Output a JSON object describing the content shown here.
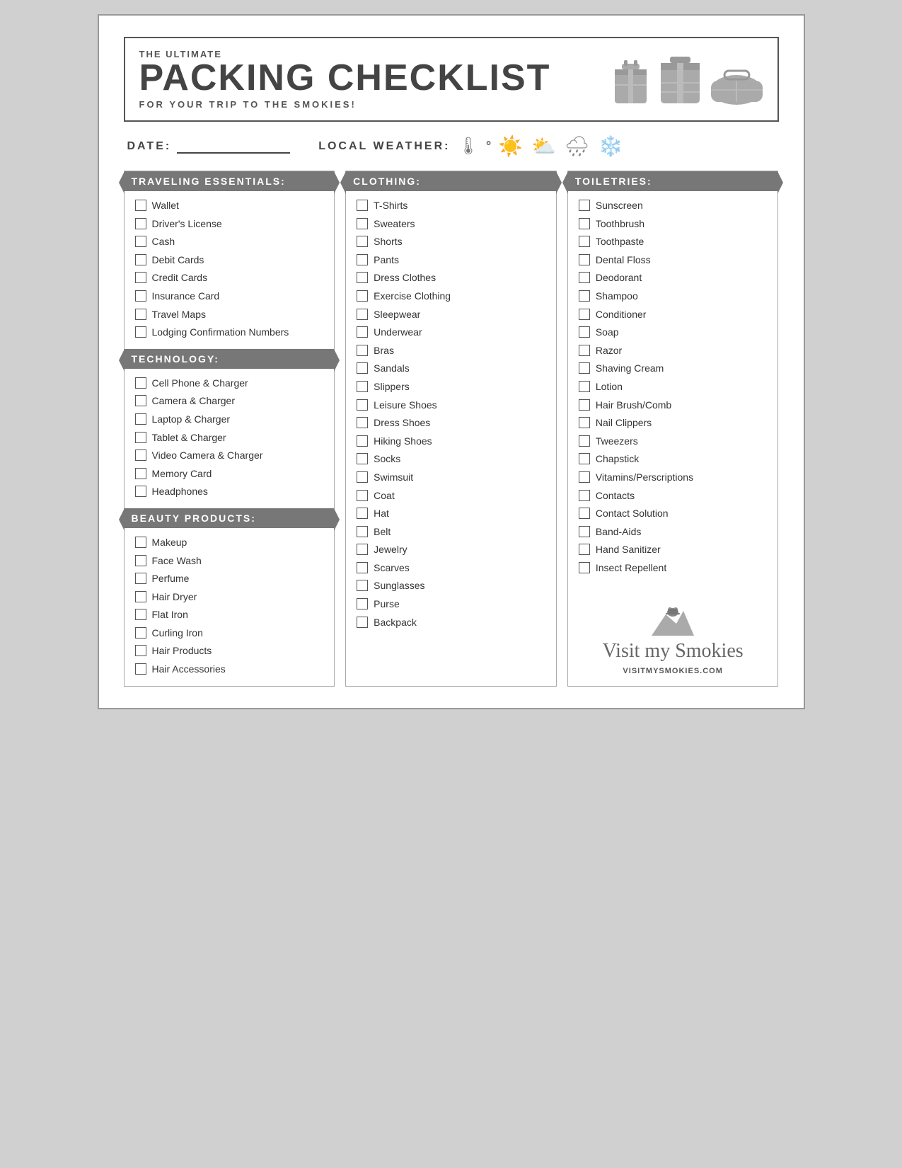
{
  "header": {
    "subtitle": "THE ULTIMATE",
    "main_title": "PACKING CHECKLIST",
    "tagline": "FOR YOUR TRIP TO THE SMOKIES!"
  },
  "info_bar": {
    "date_label": "DATE:",
    "weather_label": "LOCAL WEATHER:"
  },
  "columns": {
    "col1": {
      "sections": [
        {
          "title": "TRAVELING ESSENTIALS:",
          "items": [
            "Wallet",
            "Driver's License",
            "Cash",
            "Debit Cards",
            "Credit Cards",
            "Insurance Card",
            "Travel Maps",
            "Lodging Confirmation Numbers"
          ]
        },
        {
          "title": "TECHNOLOGY:",
          "items": [
            "Cell Phone & Charger",
            "Camera & Charger",
            "Laptop & Charger",
            "Tablet & Charger",
            "Video Camera & Charger",
            "Memory Card",
            "Headphones"
          ]
        },
        {
          "title": "BEAUTY PRODUCTS:",
          "items": [
            "Makeup",
            "Face Wash",
            "Perfume",
            "Hair Dryer",
            "Flat Iron",
            "Curling Iron",
            "Hair Products",
            "Hair Accessories"
          ]
        }
      ]
    },
    "col2": {
      "sections": [
        {
          "title": "CLOTHING:",
          "items": [
            "T-Shirts",
            "Sweaters",
            "Shorts",
            "Pants",
            "Dress Clothes",
            "Exercise Clothing",
            "Sleepwear",
            "Underwear",
            "Bras",
            "Sandals",
            "Slippers",
            "Leisure Shoes",
            "Dress Shoes",
            "Hiking Shoes",
            "Socks",
            "Swimsuit",
            "Coat",
            "Hat",
            "Belt",
            "Jewelry",
            "Scarves",
            "Sunglasses",
            "Purse",
            "Backpack"
          ]
        }
      ]
    },
    "col3": {
      "sections": [
        {
          "title": "TOILETRIES:",
          "items": [
            "Sunscreen",
            "Toothbrush",
            "Toothpaste",
            "Dental Floss",
            "Deodorant",
            "Shampoo",
            "Conditioner",
            "Soap",
            "Razor",
            "Shaving Cream",
            "Lotion",
            "Hair Brush/Comb",
            "Nail Clippers",
            "Tweezers",
            "Chapstick",
            "Vitamins/Perscriptions",
            "Contacts",
            "Contact Solution",
            "Band-Aids",
            "Hand Sanitizer",
            "Insect Repellent"
          ]
        }
      ],
      "logo": {
        "text": "Visit my Smokies",
        "url": "VISITMYSMOKIES.COM"
      }
    }
  }
}
